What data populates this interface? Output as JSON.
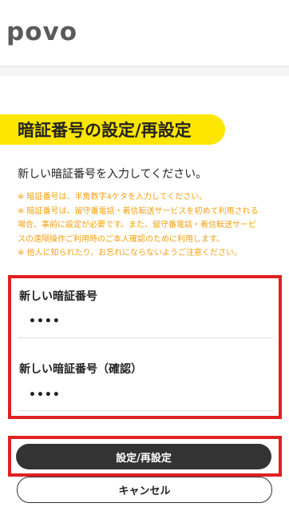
{
  "header": {
    "logo_text": "povo"
  },
  "page": {
    "title": "暗証番号の設定/再設定",
    "instruction": "新しい暗証番号を入力してください。"
  },
  "notes": [
    "※ 暗証番号は、半角数字4ケタを入力してください。",
    "※ 暗証番号は、留守番電話・着信転送サービスを初めて利用される",
    "場合、事前に設定が必要です。また、留守番電話・着信転送サービ",
    "スの遠隔操作ご利用時のご本人確認のために利用します。",
    "※ 他人に知られたり、お忘れにならないようご注意ください。"
  ],
  "form": {
    "new_pin_label": "新しい暗証番号",
    "new_pin_value": "••••",
    "confirm_pin_label": "新しい暗証番号（確認）",
    "confirm_pin_value": "••••"
  },
  "buttons": {
    "submit_label": "設定/再設定",
    "cancel_label": "キャンセル"
  },
  "colors": {
    "accent_yellow": "#ffe600",
    "note_orange": "#f5a10f",
    "highlight_red": "#e02022",
    "button_dark": "#333333"
  }
}
